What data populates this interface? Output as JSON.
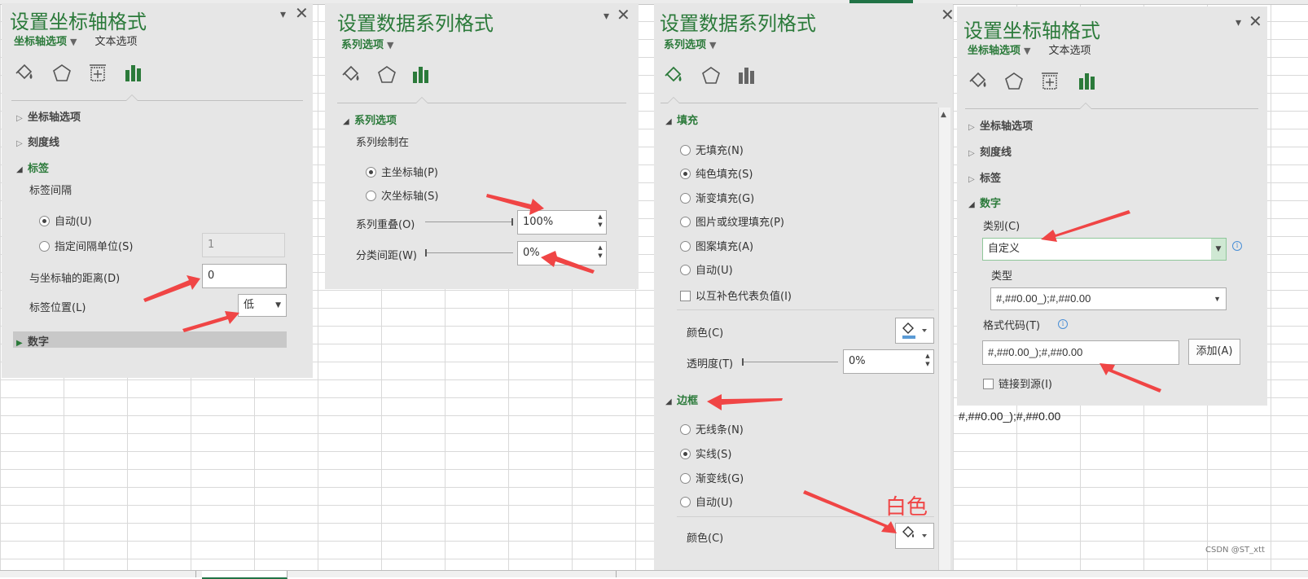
{
  "panel1": {
    "title": "设置坐标轴格式",
    "subtab_active": "坐标轴选项",
    "subtab_other": "文本选项",
    "sections": {
      "axis_options": "坐标轴选项",
      "tick_marks": "刻度线",
      "labels": "标签",
      "number": "数字"
    },
    "label_interval": "标签间隔",
    "auto": "自动(U)",
    "specify_interval": "指定间隔单位(S)",
    "interval_value": "1",
    "distance_label": "与坐标轴的距离(D)",
    "distance_value": "0",
    "position_label": "标签位置(L)",
    "position_value": "低"
  },
  "panel2": {
    "title": "设置数据系列格式",
    "subtab_active": "系列选项",
    "section": "系列选项",
    "plot_on": "系列绘制在",
    "primary_axis": "主坐标轴(P)",
    "secondary_axis": "次坐标轴(S)",
    "overlap_label": "系列重叠(O)",
    "overlap_value": "100%",
    "gap_label": "分类间距(W)",
    "gap_value": "0%"
  },
  "panel3": {
    "title": "设置数据系列格式",
    "subtab_active": "系列选项",
    "fill_section": "填充",
    "fill_options": {
      "none": "无填充(N)",
      "solid": "纯色填充(S)",
      "gradient": "渐变填充(G)",
      "picture": "图片或纹理填充(P)",
      "pattern": "图案填充(A)",
      "auto": "自动(U)"
    },
    "invert_negative": "以互补色代表负值(I)",
    "color_label": "颜色(C)",
    "transparency_label": "透明度(T)",
    "transparency_value": "0%",
    "border_section": "边框",
    "border_options": {
      "none": "无线条(N)",
      "solid": "实线(S)",
      "gradient": "渐变线(G)",
      "auto": "自动(U)"
    },
    "border_color_label": "颜色(C)"
  },
  "panel4": {
    "title": "设置坐标轴格式",
    "subtab_active": "坐标轴选项",
    "subtab_other": "文本选项",
    "sections": {
      "axis_options": "坐标轴选项",
      "tick_marks": "刻度线",
      "labels": "标签",
      "number": "数字"
    },
    "category_label": "类别(C)",
    "category_value": "自定义",
    "type_label": "类型",
    "type_value": "#,##0.00_);#,##0.00",
    "format_code_label": "格式代码(T)",
    "format_code_value": "#,##0.00_);#,##0.00",
    "add_button": "添加(A)",
    "link_source": "链接到源(I)"
  },
  "cell_value": "#,##0.00_);#,##0.00",
  "annotation_text": "白色",
  "watermark": "CSDN @ST_xtt",
  "colors": {
    "accent_green": "#2b7a3a",
    "arrow_red": "#f04545",
    "pane_bg": "#e6e6e6"
  }
}
